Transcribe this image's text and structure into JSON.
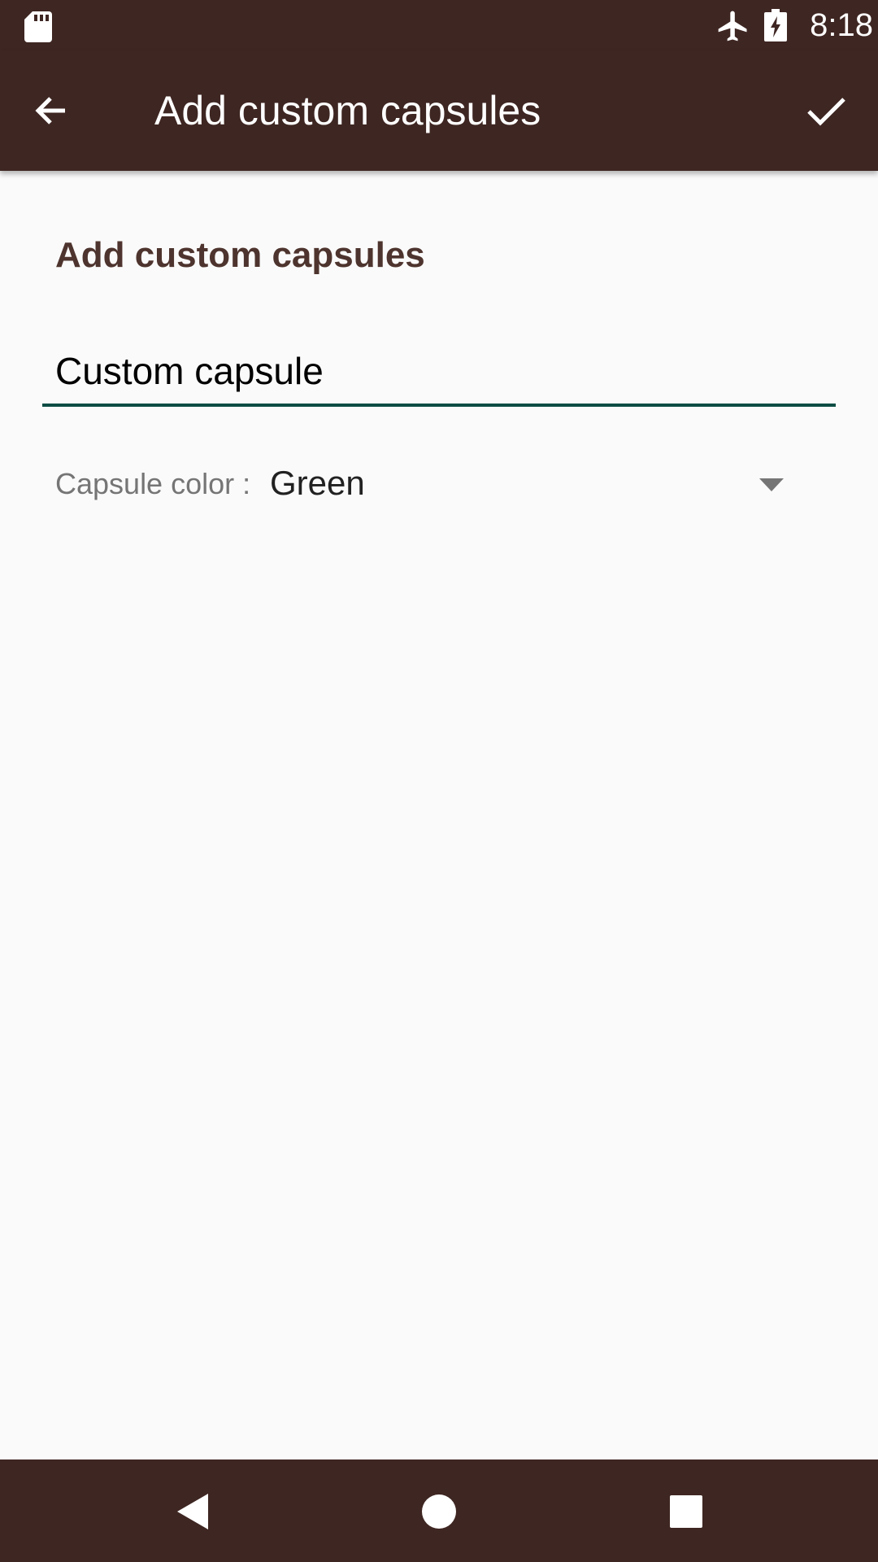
{
  "status_bar": {
    "time": "8:18",
    "icons": [
      "sd-card-icon",
      "airplane-mode-icon",
      "battery-charging-icon"
    ]
  },
  "app_bar": {
    "title": "Add custom capsules",
    "back_icon": "arrow-back-icon",
    "confirm_icon": "check-icon",
    "background_color": "#3e2622"
  },
  "form": {
    "section_title": "Add custom capsules",
    "name_field_value": "Custom capsule",
    "color_label": "Capsule color :",
    "color_value": "Green",
    "field_underline_color": "#0d4d45",
    "section_title_color": "#4e342e"
  },
  "nav_bar": {
    "icons": [
      "nav-back-icon",
      "nav-home-icon",
      "nav-recents-icon"
    ]
  }
}
